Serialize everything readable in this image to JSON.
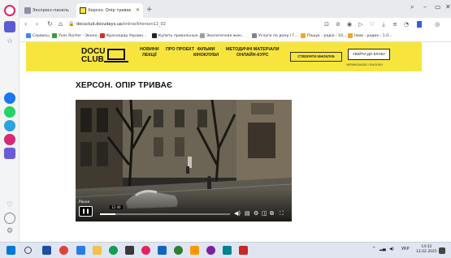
{
  "browser": {
    "tabs": [
      {
        "label": "Экспресс-панель",
        "active": false
      },
      {
        "label": "Херсон. Опір триває",
        "active": true
      }
    ],
    "new_tab_label": "+",
    "url_host": "docuclub.docudays.ua",
    "url_path": "/online/kherson12_02",
    "bookmarks": [
      "Сервисы",
      "Yves Rocher - Эколо...",
      "Краснодар Украин...",
      "Купить прикольные...",
      "Экологичная жин...",
      "Услуги по дому / Г...",
      "Пошук - радіо - 10...",
      "Ілюв - радио - 1.0..."
    ]
  },
  "site": {
    "logo_line1": "DOCU",
    "logo_line2": "CLUB",
    "menu": [
      {
        "line1": "НОВИНИ",
        "line2": "ЛЕКЦІЇ"
      },
      {
        "line1": "ПРО ПРОЕКТ",
        "line2": ""
      },
      {
        "line1": "ФІЛЬМИ",
        "line2": "КІНОКЛУБИ"
      },
      {
        "line1": "МЕТОДИЧНІ МАТЕРІАЛИ",
        "line2": "ОНЛАЙН-КУРС"
      }
    ],
    "create_button": "СТВОРИТИ КІНОКЛУБ",
    "join_button": "УВІЙТИ ДО КЛУБУ",
    "language": "УКРАЇНСЬКОЮ / ENGLISH"
  },
  "page": {
    "title": "ХЕРСОН. ОПІР ТРИВАЄ"
  },
  "player": {
    "pause_tooltip": "Pause",
    "pause_symbol": "❚❚",
    "time_tooltip": "12:40",
    "progress_fraction": 0.12,
    "icons": [
      "volume-icon",
      "subtitles-icon",
      "settings-icon",
      "miniplayer-icon",
      "cast-icon",
      "fullscreen-icon"
    ]
  },
  "taskbar": {
    "clock_time": "14:32",
    "clock_date": "12.02.2025",
    "lang": "УКР"
  }
}
